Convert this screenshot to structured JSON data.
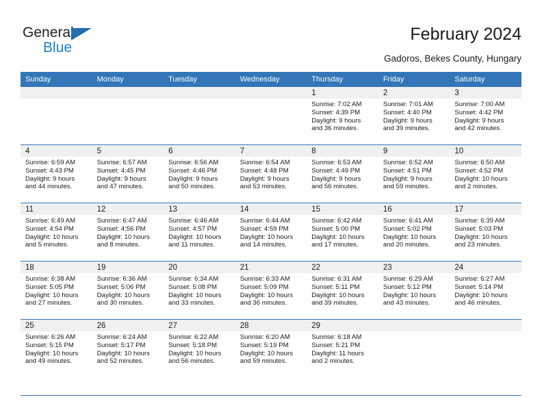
{
  "brand": {
    "name_top": "General",
    "name_bottom": "Blue",
    "triangle_color": "#1f6fb4",
    "blue_text_color": "#1b7fd4"
  },
  "header": {
    "title": "February 2024",
    "subtitle": "Gadoros, Bekes County, Hungary",
    "header_bg": "#3276b8",
    "daynum_bg": "#f0f0f0"
  },
  "weekday_headers": [
    "Sunday",
    "Monday",
    "Tuesday",
    "Wednesday",
    "Thursday",
    "Friday",
    "Saturday"
  ],
  "weeks": [
    [
      {
        "day": "",
        "sunrise": "",
        "sunset": "",
        "daylight_line1": "",
        "daylight_line2": ""
      },
      {
        "day": "",
        "sunrise": "",
        "sunset": "",
        "daylight_line1": "",
        "daylight_line2": ""
      },
      {
        "day": "",
        "sunrise": "",
        "sunset": "",
        "daylight_line1": "",
        "daylight_line2": ""
      },
      {
        "day": "",
        "sunrise": "",
        "sunset": "",
        "daylight_line1": "",
        "daylight_line2": ""
      },
      {
        "day": "1",
        "sunrise": "Sunrise: 7:02 AM",
        "sunset": "Sunset: 4:39 PM",
        "daylight_line1": "Daylight: 9 hours",
        "daylight_line2": "and 36 minutes."
      },
      {
        "day": "2",
        "sunrise": "Sunrise: 7:01 AM",
        "sunset": "Sunset: 4:40 PM",
        "daylight_line1": "Daylight: 9 hours",
        "daylight_line2": "and 39 minutes."
      },
      {
        "day": "3",
        "sunrise": "Sunrise: 7:00 AM",
        "sunset": "Sunset: 4:42 PM",
        "daylight_line1": "Daylight: 9 hours",
        "daylight_line2": "and 42 minutes."
      }
    ],
    [
      {
        "day": "4",
        "sunrise": "Sunrise: 6:59 AM",
        "sunset": "Sunset: 4:43 PM",
        "daylight_line1": "Daylight: 9 hours",
        "daylight_line2": "and 44 minutes."
      },
      {
        "day": "5",
        "sunrise": "Sunrise: 6:57 AM",
        "sunset": "Sunset: 4:45 PM",
        "daylight_line1": "Daylight: 9 hours",
        "daylight_line2": "and 47 minutes."
      },
      {
        "day": "6",
        "sunrise": "Sunrise: 6:56 AM",
        "sunset": "Sunset: 4:46 PM",
        "daylight_line1": "Daylight: 9 hours",
        "daylight_line2": "and 50 minutes."
      },
      {
        "day": "7",
        "sunrise": "Sunrise: 6:54 AM",
        "sunset": "Sunset: 4:48 PM",
        "daylight_line1": "Daylight: 9 hours",
        "daylight_line2": "and 53 minutes."
      },
      {
        "day": "8",
        "sunrise": "Sunrise: 6:53 AM",
        "sunset": "Sunset: 4:49 PM",
        "daylight_line1": "Daylight: 9 hours",
        "daylight_line2": "and 56 minutes."
      },
      {
        "day": "9",
        "sunrise": "Sunrise: 6:52 AM",
        "sunset": "Sunset: 4:51 PM",
        "daylight_line1": "Daylight: 9 hours",
        "daylight_line2": "and 59 minutes."
      },
      {
        "day": "10",
        "sunrise": "Sunrise: 6:50 AM",
        "sunset": "Sunset: 4:52 PM",
        "daylight_line1": "Daylight: 10 hours",
        "daylight_line2": "and 2 minutes."
      }
    ],
    [
      {
        "day": "11",
        "sunrise": "Sunrise: 6:49 AM",
        "sunset": "Sunset: 4:54 PM",
        "daylight_line1": "Daylight: 10 hours",
        "daylight_line2": "and 5 minutes."
      },
      {
        "day": "12",
        "sunrise": "Sunrise: 6:47 AM",
        "sunset": "Sunset: 4:56 PM",
        "daylight_line1": "Daylight: 10 hours",
        "daylight_line2": "and 8 minutes."
      },
      {
        "day": "13",
        "sunrise": "Sunrise: 6:46 AM",
        "sunset": "Sunset: 4:57 PM",
        "daylight_line1": "Daylight: 10 hours",
        "daylight_line2": "and 11 minutes."
      },
      {
        "day": "14",
        "sunrise": "Sunrise: 6:44 AM",
        "sunset": "Sunset: 4:59 PM",
        "daylight_line1": "Daylight: 10 hours",
        "daylight_line2": "and 14 minutes."
      },
      {
        "day": "15",
        "sunrise": "Sunrise: 6:42 AM",
        "sunset": "Sunset: 5:00 PM",
        "daylight_line1": "Daylight: 10 hours",
        "daylight_line2": "and 17 minutes."
      },
      {
        "day": "16",
        "sunrise": "Sunrise: 6:41 AM",
        "sunset": "Sunset: 5:02 PM",
        "daylight_line1": "Daylight: 10 hours",
        "daylight_line2": "and 20 minutes."
      },
      {
        "day": "17",
        "sunrise": "Sunrise: 6:39 AM",
        "sunset": "Sunset: 5:03 PM",
        "daylight_line1": "Daylight: 10 hours",
        "daylight_line2": "and 23 minutes."
      }
    ],
    [
      {
        "day": "18",
        "sunrise": "Sunrise: 6:38 AM",
        "sunset": "Sunset: 5:05 PM",
        "daylight_line1": "Daylight: 10 hours",
        "daylight_line2": "and 27 minutes."
      },
      {
        "day": "19",
        "sunrise": "Sunrise: 6:36 AM",
        "sunset": "Sunset: 5:06 PM",
        "daylight_line1": "Daylight: 10 hours",
        "daylight_line2": "and 30 minutes."
      },
      {
        "day": "20",
        "sunrise": "Sunrise: 6:34 AM",
        "sunset": "Sunset: 5:08 PM",
        "daylight_line1": "Daylight: 10 hours",
        "daylight_line2": "and 33 minutes."
      },
      {
        "day": "21",
        "sunrise": "Sunrise: 6:33 AM",
        "sunset": "Sunset: 5:09 PM",
        "daylight_line1": "Daylight: 10 hours",
        "daylight_line2": "and 36 minutes."
      },
      {
        "day": "22",
        "sunrise": "Sunrise: 6:31 AM",
        "sunset": "Sunset: 5:11 PM",
        "daylight_line1": "Daylight: 10 hours",
        "daylight_line2": "and 39 minutes."
      },
      {
        "day": "23",
        "sunrise": "Sunrise: 6:29 AM",
        "sunset": "Sunset: 5:12 PM",
        "daylight_line1": "Daylight: 10 hours",
        "daylight_line2": "and 43 minutes."
      },
      {
        "day": "24",
        "sunrise": "Sunrise: 6:27 AM",
        "sunset": "Sunset: 5:14 PM",
        "daylight_line1": "Daylight: 10 hours",
        "daylight_line2": "and 46 minutes."
      }
    ],
    [
      {
        "day": "25",
        "sunrise": "Sunrise: 6:26 AM",
        "sunset": "Sunset: 5:15 PM",
        "daylight_line1": "Daylight: 10 hours",
        "daylight_line2": "and 49 minutes."
      },
      {
        "day": "26",
        "sunrise": "Sunrise: 6:24 AM",
        "sunset": "Sunset: 5:17 PM",
        "daylight_line1": "Daylight: 10 hours",
        "daylight_line2": "and 52 minutes."
      },
      {
        "day": "27",
        "sunrise": "Sunrise: 6:22 AM",
        "sunset": "Sunset: 5:18 PM",
        "daylight_line1": "Daylight: 10 hours",
        "daylight_line2": "and 56 minutes."
      },
      {
        "day": "28",
        "sunrise": "Sunrise: 6:20 AM",
        "sunset": "Sunset: 5:19 PM",
        "daylight_line1": "Daylight: 10 hours",
        "daylight_line2": "and 59 minutes."
      },
      {
        "day": "29",
        "sunrise": "Sunrise: 6:18 AM",
        "sunset": "Sunset: 5:21 PM",
        "daylight_line1": "Daylight: 11 hours",
        "daylight_line2": "and 2 minutes."
      },
      {
        "day": "",
        "sunrise": "",
        "sunset": "",
        "daylight_line1": "",
        "daylight_line2": ""
      },
      {
        "day": "",
        "sunrise": "",
        "sunset": "",
        "daylight_line1": "",
        "daylight_line2": ""
      }
    ]
  ]
}
